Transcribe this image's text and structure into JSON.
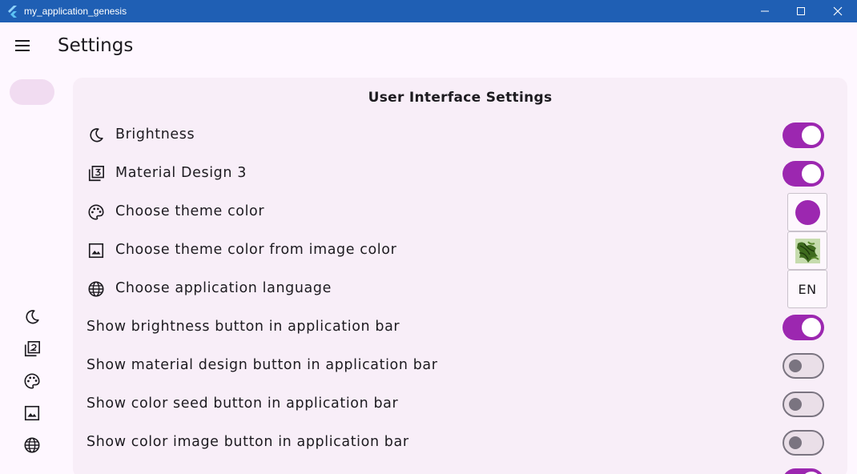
{
  "window": {
    "title": "my_application_genesis",
    "bar_color": "#1f5fb4"
  },
  "appbar": {
    "title": "Settings",
    "menu_icon": "menu-icon"
  },
  "nav_rail": {
    "items": [
      {
        "icon": "moon-icon"
      },
      {
        "icon": "filter-2-icon"
      },
      {
        "icon": "palette-icon"
      },
      {
        "icon": "image-icon"
      },
      {
        "icon": "globe-icon"
      }
    ]
  },
  "card": {
    "title": "User Interface Settings",
    "rows": [
      {
        "icon": "moon-icon",
        "label": "Brightness",
        "control": "switch",
        "on": true
      },
      {
        "icon": "filter-3-icon",
        "label": "Material Design 3",
        "control": "switch",
        "on": true
      },
      {
        "icon": "palette-icon",
        "label": "Choose theme color",
        "control": "color",
        "color": "#9c27b0"
      },
      {
        "icon": "image-icon",
        "label": "Choose theme color from image color",
        "control": "image"
      },
      {
        "icon": "globe-icon",
        "label": "Choose application language",
        "control": "language",
        "value": "EN"
      },
      {
        "label": "Show brightness button in application bar",
        "control": "switch",
        "on": true
      },
      {
        "label": "Show material design button in application bar",
        "control": "switch",
        "on": false
      },
      {
        "label": "Show color seed button in application bar",
        "control": "switch",
        "on": false
      },
      {
        "label": "Show color image button in application bar",
        "control": "switch",
        "on": false
      }
    ]
  },
  "colors": {
    "accent": "#9c27b0",
    "background": "#fef7ff",
    "card": "#f8eef8"
  }
}
